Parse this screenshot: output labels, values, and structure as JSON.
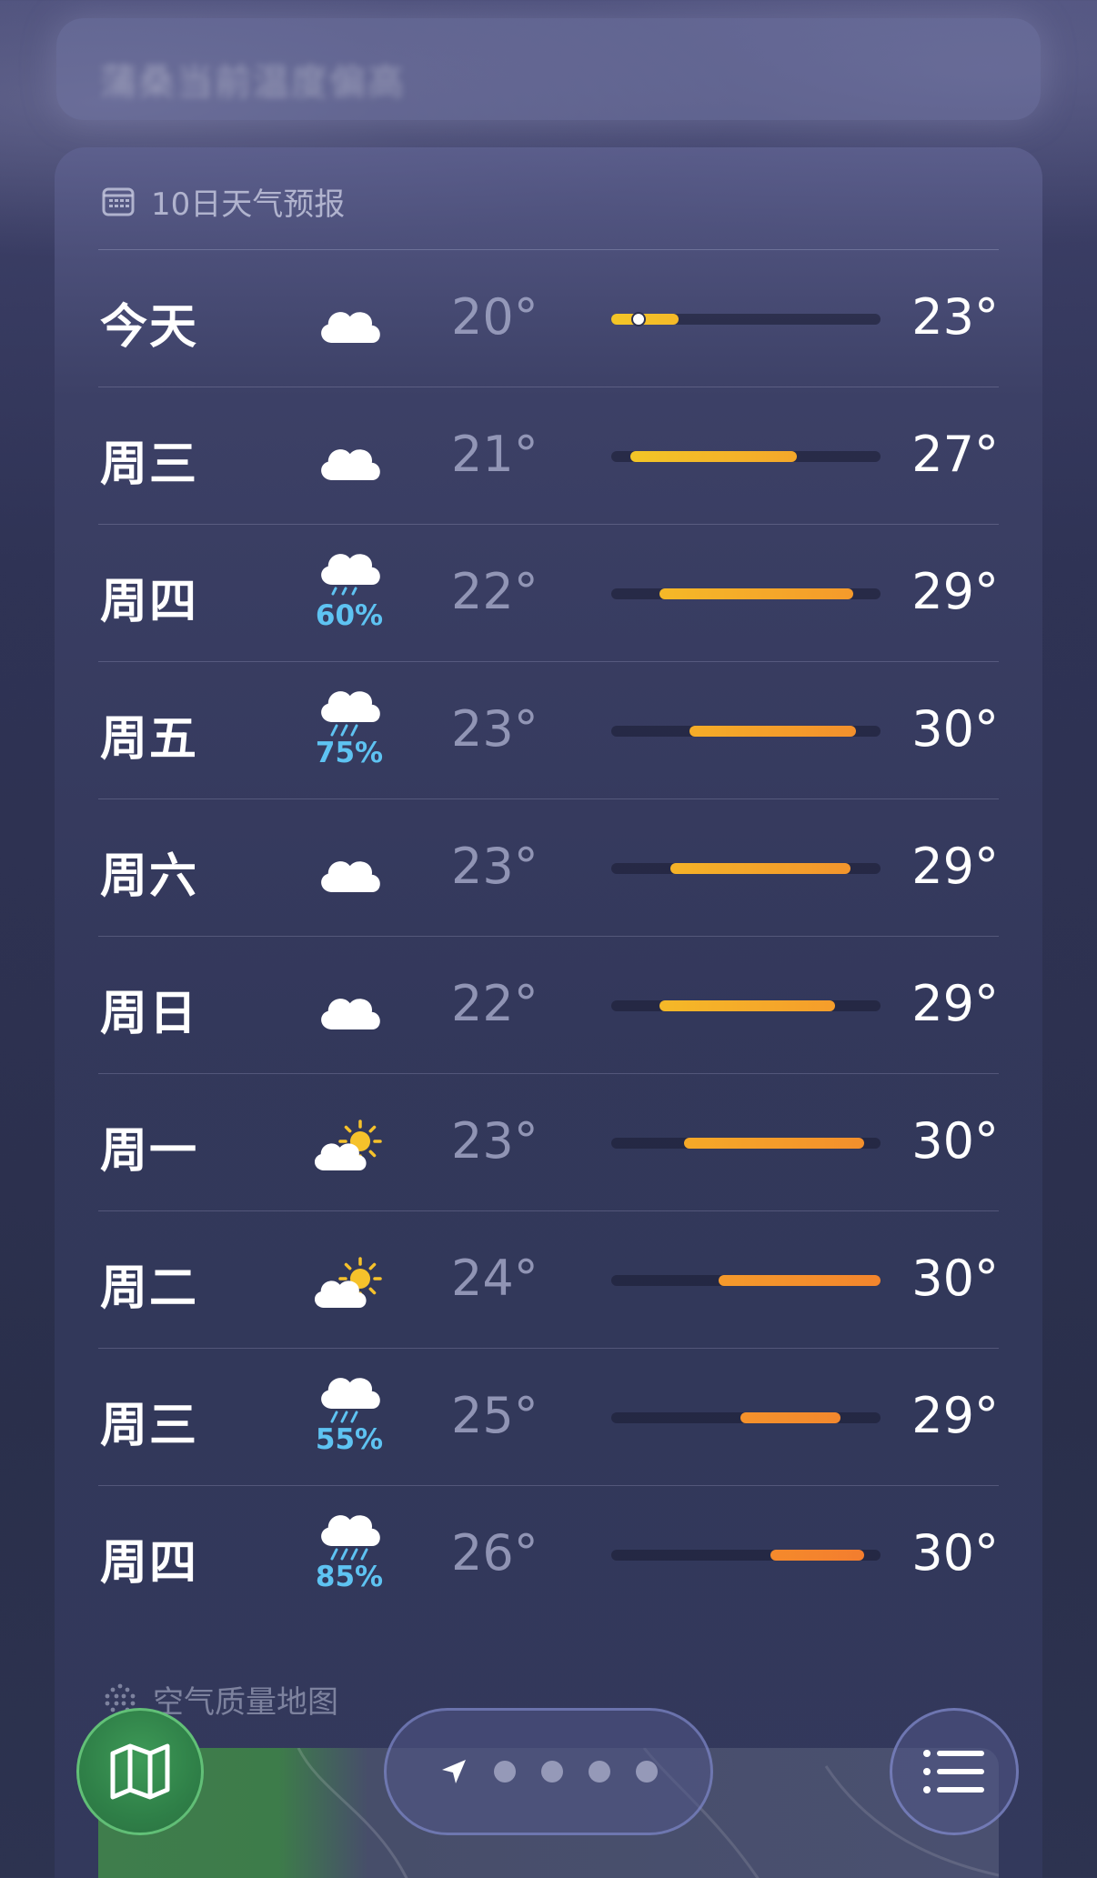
{
  "top": {
    "blurred_text": "蒲桑当前温度偏高"
  },
  "forecast": {
    "title": "10日天气预报",
    "icon": "calendar-icon",
    "days": [
      {
        "day": "今天",
        "icon": "cloud",
        "precip": "",
        "low": "20°",
        "high": "23°",
        "bar_start": 0.0,
        "bar_end": 0.25,
        "current_marker": 0.1,
        "colors": [
          "#f3c627",
          "#f5b928"
        ]
      },
      {
        "day": "周三",
        "icon": "cloud",
        "precip": "",
        "low": "21°",
        "high": "27°",
        "bar_start": 0.07,
        "bar_end": 0.69,
        "current_marker": null,
        "colors": [
          "#f3c627",
          "#f4a72a"
        ]
      },
      {
        "day": "周四",
        "icon": "cloud-rain-light",
        "precip": "60%",
        "low": "22°",
        "high": "29°",
        "bar_start": 0.18,
        "bar_end": 0.9,
        "current_marker": null,
        "colors": [
          "#f5b928",
          "#f59a2b"
        ]
      },
      {
        "day": "周五",
        "icon": "cloud-rain",
        "precip": "75%",
        "low": "23°",
        "high": "30°",
        "bar_start": 0.29,
        "bar_end": 0.91,
        "current_marker": null,
        "colors": [
          "#f5ad28",
          "#f3902c"
        ]
      },
      {
        "day": "周六",
        "icon": "cloud",
        "precip": "",
        "low": "23°",
        "high": "29°",
        "bar_start": 0.22,
        "bar_end": 0.89,
        "current_marker": null,
        "colors": [
          "#f5b328",
          "#f3952c"
        ]
      },
      {
        "day": "周日",
        "icon": "cloud",
        "precip": "",
        "low": "22°",
        "high": "29°",
        "bar_start": 0.18,
        "bar_end": 0.83,
        "current_marker": null,
        "colors": [
          "#f5b928",
          "#f59d2b"
        ]
      },
      {
        "day": "周一",
        "icon": "partly-sunny",
        "precip": "",
        "low": "23°",
        "high": "30°",
        "bar_start": 0.27,
        "bar_end": 0.94,
        "current_marker": null,
        "colors": [
          "#f5a928",
          "#f38f2c"
        ]
      },
      {
        "day": "周二",
        "icon": "partly-sunny",
        "precip": "",
        "low": "24°",
        "high": "30°",
        "bar_start": 0.4,
        "bar_end": 1.0,
        "current_marker": null,
        "colors": [
          "#f59a2b",
          "#f3852d"
        ]
      },
      {
        "day": "周三",
        "icon": "cloud-rain",
        "precip": "55%",
        "low": "25°",
        "high": "29°",
        "bar_start": 0.48,
        "bar_end": 0.85,
        "current_marker": null,
        "colors": [
          "#f5922b",
          "#f3882d"
        ]
      },
      {
        "day": "周四",
        "icon": "cloud-heavy-rain",
        "precip": "85%",
        "low": "26°",
        "high": "30°",
        "bar_start": 0.59,
        "bar_end": 0.94,
        "current_marker": null,
        "colors": [
          "#f58a2c",
          "#f37d2e"
        ]
      }
    ]
  },
  "air_quality": {
    "title": "空气质量地图",
    "icon": "dots-grid-icon"
  },
  "bottom_bar": {
    "map_button": "map-icon",
    "pager_pages": 4,
    "list_button": "list-icon",
    "footer_text": "「"
  }
}
